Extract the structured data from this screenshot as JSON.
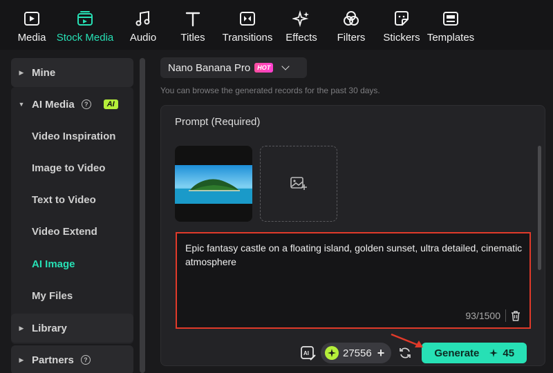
{
  "toolbar": {
    "items": [
      {
        "label": "Media",
        "icon": "media-icon"
      },
      {
        "label": "Stock Media",
        "icon": "stock-media-icon",
        "active": true
      },
      {
        "label": "Audio",
        "icon": "music-note-icon"
      },
      {
        "label": "Titles",
        "icon": "text-t-icon"
      },
      {
        "label": "Transitions",
        "icon": "transition-icon"
      },
      {
        "label": "Effects",
        "icon": "sparkle-icon"
      },
      {
        "label": "Filters",
        "icon": "filter-icon"
      },
      {
        "label": "Stickers",
        "icon": "sticker-icon"
      },
      {
        "label": "Templates",
        "icon": "template-icon"
      }
    ]
  },
  "sidebar": {
    "mine": "Mine",
    "ai_media": "AI Media",
    "ai_badge": "AI",
    "sub_items": [
      "Video Inspiration",
      "Image to Video",
      "Text to Video",
      "Video Extend",
      "AI Image",
      "My Files"
    ],
    "active_sub": "AI Image",
    "library": "Library",
    "partners": "Partners"
  },
  "main": {
    "model_name": "Nano Banana Pro",
    "model_badge": "HOT",
    "hint": "You can browse the generated records for the past 30 days.",
    "prompt_title": "Prompt (Required)",
    "prompt_text": "Epic fantasy castle on a floating island, golden sunset, ultra detailed, cinematic atmosphere",
    "counter": "93/1500",
    "credits": "27556",
    "generate_label": "Generate",
    "generate_cost": "45"
  },
  "colors": {
    "accent": "#27e0b5",
    "ai_badge": "#b5ef3a",
    "highlight_border": "#e13a2a"
  }
}
